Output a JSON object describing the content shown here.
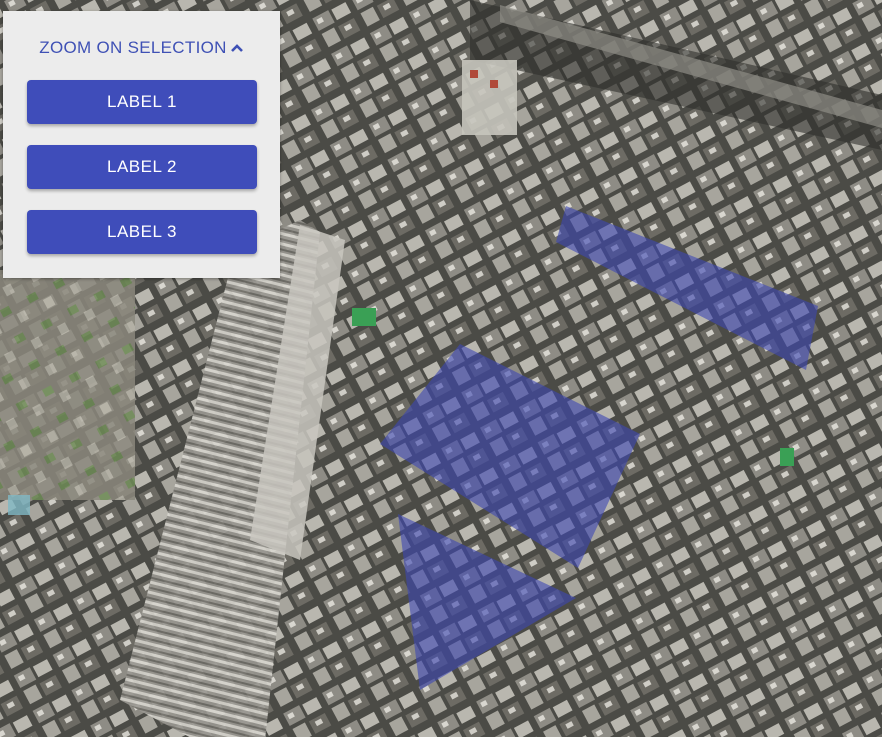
{
  "panel": {
    "zoom_label": "ZOOM ON SELECTION",
    "zoom_icon": "chevron-up-icon",
    "buttons": [
      "LABEL 1",
      "LABEL 2",
      "LABEL 3"
    ]
  },
  "map": {
    "imagery": "aerial satellite view of dense city blocks with railway tracks",
    "selection_color": "#3c46b4"
  },
  "colors": {
    "accent": "#3f51b5",
    "button_bg": "#3f4dba",
    "panel_bg": "#ececec"
  }
}
